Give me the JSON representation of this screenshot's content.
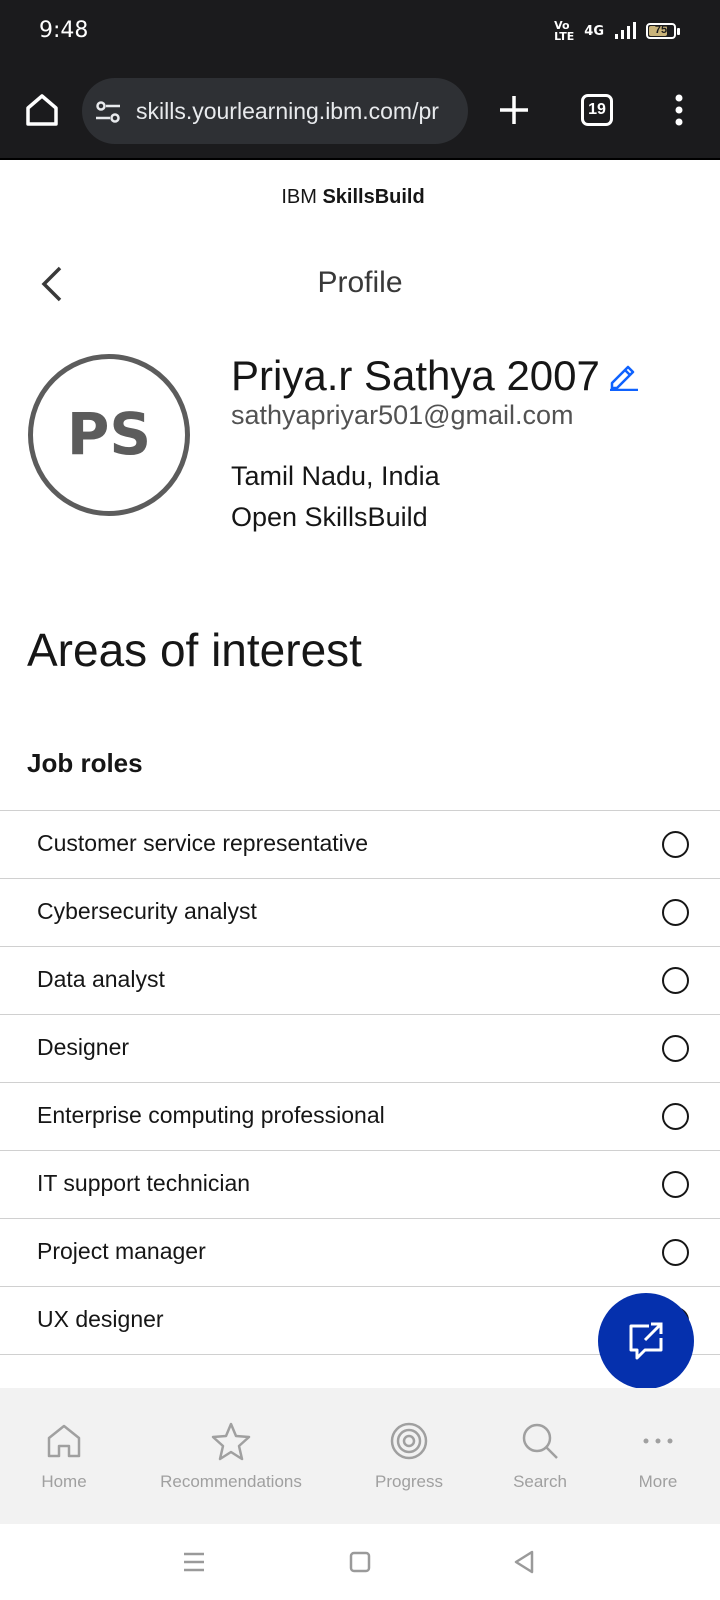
{
  "status_bar": {
    "time": "9:48",
    "network_top": "Vo",
    "network_bottom": "LTE",
    "signal_label": "4G",
    "battery": "75",
    "battery_level": 0.75
  },
  "browser": {
    "url": "skills.yourlearning.ibm.com/pr",
    "tab_count": "19"
  },
  "brand": {
    "prefix": "IBM ",
    "name": "SkillsBuild"
  },
  "page": {
    "title": "Profile"
  },
  "profile": {
    "initials": "PS",
    "name": "Priya.r Sathya 2007",
    "email": "sathyapriyar501@gmail.com",
    "location": "Tamil Nadu, India",
    "organization": "Open SkillsBuild"
  },
  "interests": {
    "title": "Areas of interest",
    "job_roles_heading": "Job roles",
    "job_roles": [
      "Customer service representative",
      "Cybersecurity analyst",
      "Data analyst",
      "Designer",
      "Enterprise computing professional",
      "IT support technician",
      "Project manager",
      "UX designer"
    ]
  },
  "bottom_nav": {
    "items": [
      {
        "label": "Home",
        "icon": "home-icon"
      },
      {
        "label": "Recommendations",
        "icon": "star-icon"
      },
      {
        "label": "Progress",
        "icon": "progress-icon"
      },
      {
        "label": "Search",
        "icon": "search-icon"
      },
      {
        "label": "More",
        "icon": "more-icon"
      }
    ]
  },
  "colors": {
    "accent": "#0530ad",
    "link": "#0f62fe",
    "browser_chrome": "#1b1b1d"
  }
}
